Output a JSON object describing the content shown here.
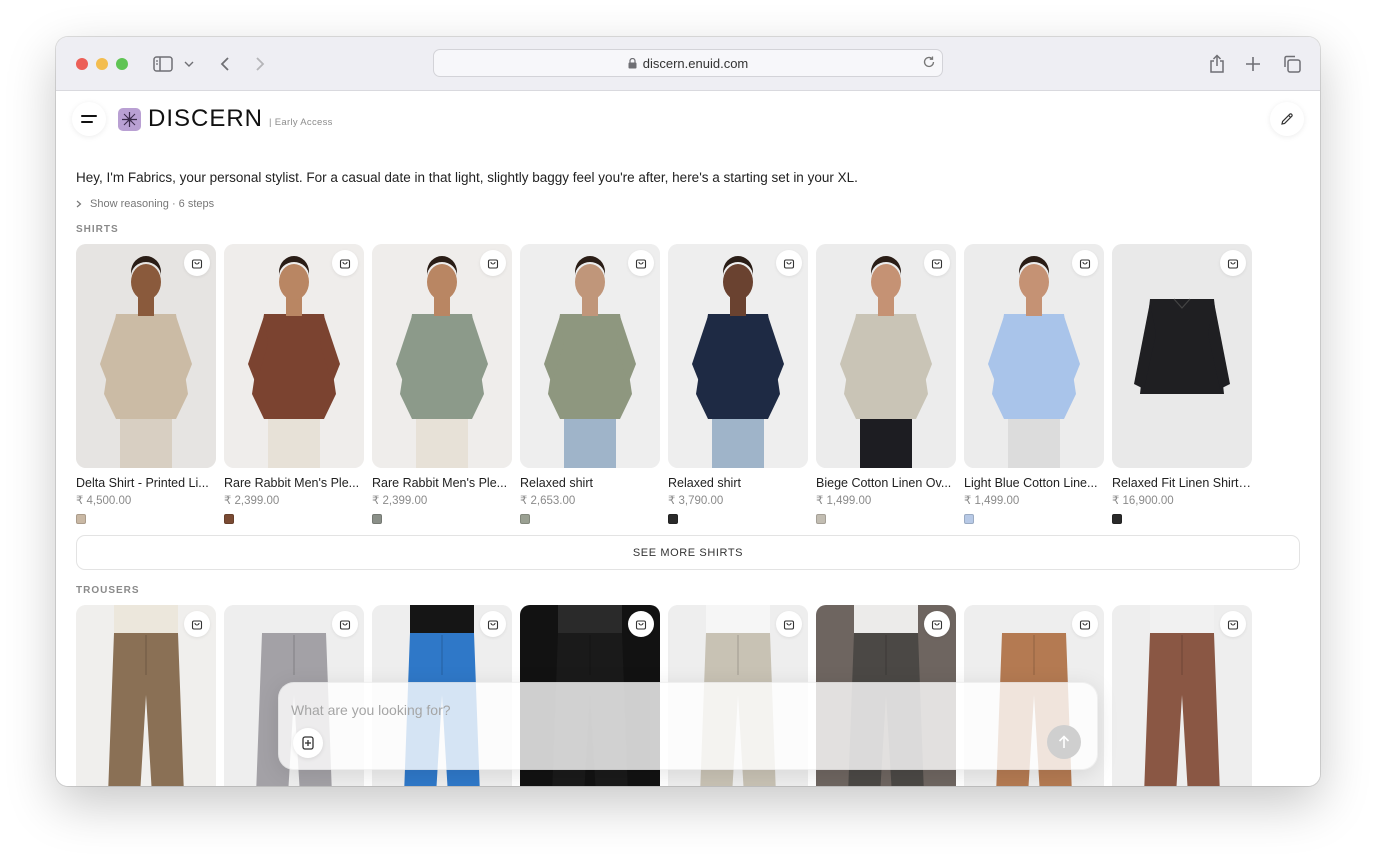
{
  "browser": {
    "url": "discern.enuid.com"
  },
  "brand": {
    "name": "DISCERN",
    "tag": "| Early Access"
  },
  "chat_intro": {
    "greeting": "Hey, I'm Fabrics, your personal stylist. For a casual date in that light, slightly baggy feel you're after, here's a starting set in your XL.",
    "reasoning": "Show reasoning · 6 steps"
  },
  "shirts": {
    "title": "SHIRTS",
    "see_more": "SEE MORE SHIRTS",
    "items": [
      {
        "name": "Delta Shirt - Printed Li...",
        "price": "₹ 4,500.00",
        "swatch": "#c9b8a4",
        "garment": "#cbbba5",
        "bg": "#e6e4e2",
        "skin": "#8a5a3c",
        "legs": "#d8cfc2"
      },
      {
        "name": "Rare Rabbit Men's Ple...",
        "price": "₹ 2,399.00",
        "swatch": "#7a4a33",
        "garment": "#7b4330",
        "bg": "#efedeb",
        "skin": "#b98663",
        "legs": "#e7e1d7"
      },
      {
        "name": "Rare Rabbit Men's Ple...",
        "price": "₹ 2,399.00",
        "swatch": "#8a8f88",
        "garment": "#8c9a8a",
        "bg": "#efedeb",
        "skin": "#b98663",
        "legs": "#e7e1d7"
      },
      {
        "name": "Relaxed shirt",
        "price": "₹ 2,653.00",
        "swatch": "#9aa092",
        "garment": "#8e977f",
        "bg": "#eeeeee",
        "skin": "#c0967a",
        "legs": "#9fb4c9"
      },
      {
        "name": "Relaxed shirt",
        "price": "₹ 3,790.00",
        "swatch": "#2a2a2a",
        "garment": "#1e2a44",
        "bg": "#eeeeee",
        "skin": "#6a4230",
        "legs": "#9fb4c9"
      },
      {
        "name": "Biege Cotton Linen Ov...",
        "price": "₹ 1,499.00",
        "swatch": "#c2bdb2",
        "garment": "#c9c4b6",
        "bg": "#ececec",
        "skin": "#c59274",
        "legs": "#1d1d22"
      },
      {
        "name": "Light Blue Cotton Line...",
        "price": "₹ 1,499.00",
        "swatch": "#b7c9e6",
        "garment": "#a9c4ea",
        "bg": "#ececec",
        "skin": "#c59274",
        "legs": "#dcdcdc"
      },
      {
        "name": "Relaxed Fit Linen Shirt ...",
        "price": "₹ 16,900.00",
        "swatch": "#2a2a2a",
        "garment": "#1f1f22",
        "bg": "#e9e9e9",
        "skin": "",
        "legs": ""
      }
    ]
  },
  "trousers": {
    "title": "TROUSERS",
    "items": [
      {
        "bg": "#f0efed",
        "garment": "#8a7055",
        "top": "#ece7dc"
      },
      {
        "bg": "#eeeeee",
        "garment": "#a3a1a6",
        "top": "#eeeeee"
      },
      {
        "bg": "#eeeeee",
        "garment": "#2f78c8",
        "top": "#151515"
      },
      {
        "bg": "#121212",
        "garment": "#1a1a1a",
        "top": "#2a2a2a"
      },
      {
        "bg": "#eeeeee",
        "garment": "#c8c2b4",
        "top": "#f6f6f6"
      },
      {
        "bg": "#6e6560",
        "garment": "#4b4845",
        "top": "#ecebea"
      },
      {
        "bg": "#eeeeee",
        "garment": "#b47a52",
        "top": "#eeeeee"
      },
      {
        "bg": "#eeeeee",
        "garment": "#8a5744",
        "top": "#f1f1f1"
      }
    ]
  },
  "composer": {
    "placeholder": "What are you looking for?"
  }
}
